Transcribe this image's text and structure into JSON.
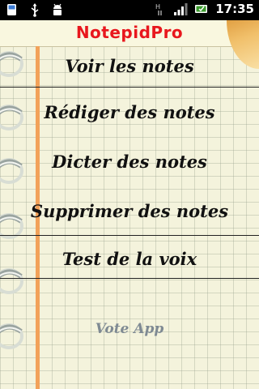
{
  "status_bar": {
    "time": "17:35",
    "left_icons": [
      "sd-card-icon",
      "usb-icon",
      "android-debug-icon"
    ],
    "right_icons": [
      "hspa-icon",
      "signal-icon",
      "battery-icon"
    ]
  },
  "app": {
    "title": "NotepidPro",
    "title_color": "#e8171d"
  },
  "menu": {
    "items": [
      {
        "label": "Voir les notes"
      },
      {
        "label": "Rédiger des notes"
      },
      {
        "label": "Dicter des notes"
      },
      {
        "label": "Supprimer des notes"
      },
      {
        "label": "Test de la voix"
      }
    ],
    "vote_label": "Vote App"
  }
}
